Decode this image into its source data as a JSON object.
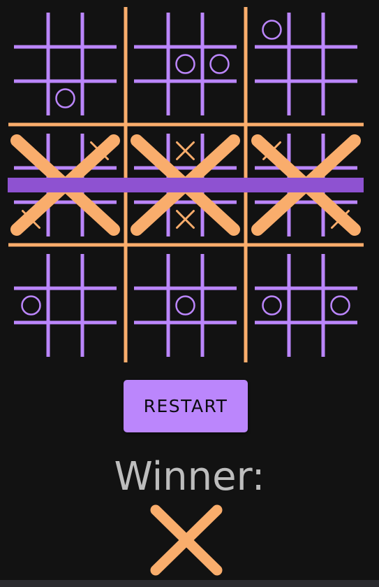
{
  "colors": {
    "background": "#121212",
    "inner_grid": "#bb86fc",
    "outer_grid": "#f9ad6c",
    "o_mark": "#bb86fc",
    "x_mark": "#f9ad6c",
    "win_line": "#8e52d1",
    "button_bg": "#bb86fc",
    "button_text": "#0b0b10",
    "winner_text": "#bdbdbd"
  },
  "board": {
    "small_boards": [
      [
        null,
        null,
        null,
        null,
        null,
        null,
        null,
        "O",
        null
      ],
      [
        null,
        null,
        null,
        null,
        "O",
        "O",
        null,
        null,
        null
      ],
      [
        "O",
        null,
        null,
        null,
        null,
        null,
        null,
        null,
        null
      ],
      [
        null,
        null,
        "X",
        null,
        null,
        null,
        "X",
        null,
        null
      ],
      [
        null,
        "X",
        null,
        null,
        null,
        null,
        null,
        "X",
        null
      ],
      [
        "X",
        null,
        null,
        null,
        null,
        null,
        null,
        null,
        "X"
      ],
      [
        null,
        null,
        null,
        "O",
        null,
        null,
        null,
        null,
        null
      ],
      [
        null,
        null,
        null,
        null,
        "O",
        null,
        null,
        null,
        null
      ],
      [
        null,
        null,
        null,
        "O",
        null,
        "O",
        null,
        null,
        null
      ]
    ],
    "big_winners": [
      null,
      null,
      null,
      "X",
      "X",
      "X",
      null,
      null,
      null
    ],
    "win_line": "middle-row"
  },
  "controls": {
    "restart_label": "RESTART"
  },
  "status": {
    "winner_label": "Winner:",
    "winner_mark": "X",
    "winner_icon": "x-mark-icon"
  }
}
